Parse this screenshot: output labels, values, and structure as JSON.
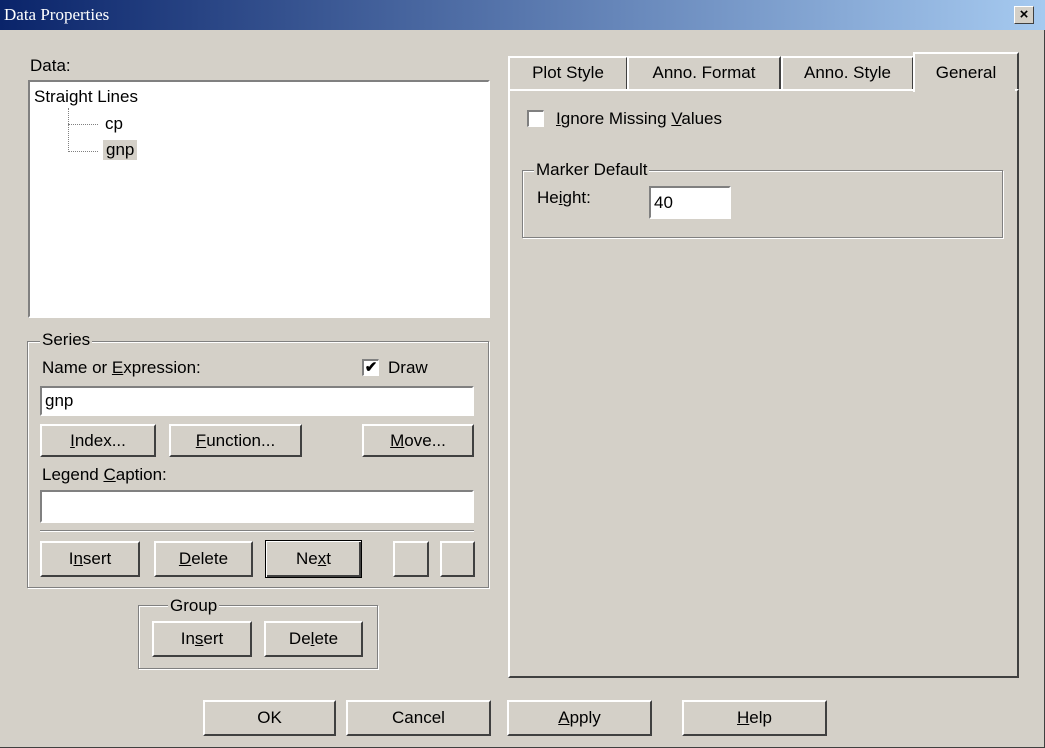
{
  "window": {
    "title": "Data Properties",
    "close_glyph": "×"
  },
  "data_panel": {
    "label": "Data:",
    "tree": {
      "root": "Straight Lines",
      "children": [
        "cp",
        "gnp"
      ],
      "selected": "gnp"
    }
  },
  "series": {
    "legend": "Series",
    "name_label": "Name or Expression:",
    "draw_label": "Draw",
    "draw_checked": true,
    "name_value": "gnp",
    "index_button": "Index...",
    "function_button": "Function...",
    "move_button": "Move...",
    "caption_label": "Legend Caption:",
    "caption_value": "",
    "insert_button": "Insert",
    "delete_button": "Delete",
    "next_button": "Next"
  },
  "group": {
    "legend": "Group",
    "insert_button": "Insert",
    "delete_button": "Delete"
  },
  "tabs": [
    "Plot Style",
    "Anno. Format",
    "Anno. Style",
    "General"
  ],
  "active_tab": "General",
  "general": {
    "ignore_missing_label": "Ignore Missing Values",
    "ignore_missing_checked": false,
    "marker_default_legend": "Marker Default",
    "height_label": "Height:",
    "height_value": "40"
  },
  "buttons": {
    "ok": "OK",
    "cancel": "Cancel",
    "apply": "Apply",
    "help": "Help"
  }
}
